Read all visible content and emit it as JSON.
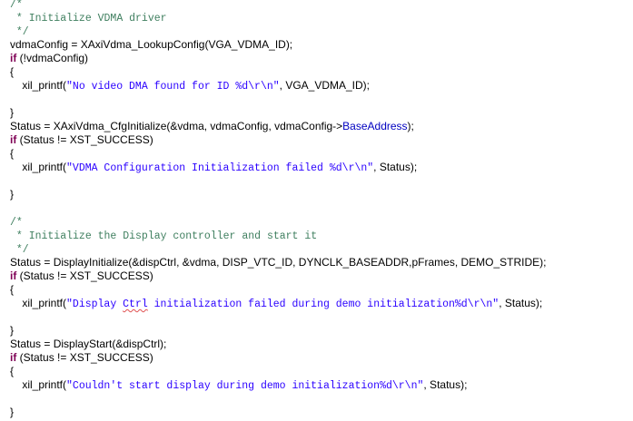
{
  "editor": {
    "lines": [
      {
        "tokens": [
          {
            "type": "comment",
            "text": "/*"
          }
        ]
      },
      {
        "tokens": [
          {
            "type": "comment",
            "text": " * Initialize VDMA driver"
          }
        ]
      },
      {
        "tokens": [
          {
            "type": "comment",
            "text": " */"
          }
        ]
      },
      {
        "tokens": [
          {
            "type": "plain",
            "text": "vdmaConfig = XAxiVdma_LookupConfig(VGA_VDMA_ID);"
          }
        ]
      },
      {
        "tokens": [
          {
            "type": "keyword",
            "text": "if"
          },
          {
            "type": "plain",
            "text": " (!vdmaConfig)"
          }
        ]
      },
      {
        "tokens": [
          {
            "type": "plain",
            "text": "{"
          }
        ]
      },
      {
        "tokens": [
          {
            "type": "plain",
            "text": "    xil_printf("
          },
          {
            "type": "string",
            "text": "\"No video DMA found for ID %d\\r\\n\""
          },
          {
            "type": "plain",
            "text": ", VGA_VDMA_ID);"
          }
        ]
      },
      {
        "tokens": []
      },
      {
        "tokens": [
          {
            "type": "plain",
            "text": "}"
          }
        ]
      },
      {
        "tokens": [
          {
            "type": "plain",
            "text": "Status = XAxiVdma_CfgInitialize(&vdma, vdmaConfig, vdmaConfig->"
          },
          {
            "type": "field",
            "text": "BaseAddress"
          },
          {
            "type": "plain",
            "text": ");"
          }
        ]
      },
      {
        "tokens": [
          {
            "type": "keyword",
            "text": "if"
          },
          {
            "type": "plain",
            "text": " (Status != XST_SUCCESS)"
          }
        ]
      },
      {
        "tokens": [
          {
            "type": "plain",
            "text": "{"
          }
        ]
      },
      {
        "tokens": [
          {
            "type": "plain",
            "text": "    xil_printf("
          },
          {
            "type": "string",
            "text": "\"VDMA Configuration Initialization failed %d\\r\\n\""
          },
          {
            "type": "plain",
            "text": ", Status);"
          }
        ]
      },
      {
        "tokens": []
      },
      {
        "tokens": [
          {
            "type": "plain",
            "text": "}"
          }
        ]
      },
      {
        "tokens": []
      },
      {
        "tokens": [
          {
            "type": "comment",
            "text": "/*"
          }
        ]
      },
      {
        "tokens": [
          {
            "type": "comment",
            "text": " * Initialize the Display controller and start it"
          }
        ]
      },
      {
        "tokens": [
          {
            "type": "comment",
            "text": " */"
          }
        ]
      },
      {
        "tokens": [
          {
            "type": "plain",
            "text": "Status = DisplayInitialize(&dispCtrl, &vdma, DISP_VTC_ID, DYNCLK_BASEADDR,pFrames, DEMO_STRIDE);"
          }
        ]
      },
      {
        "tokens": [
          {
            "type": "keyword",
            "text": "if"
          },
          {
            "type": "plain",
            "text": " (Status != XST_SUCCESS)"
          }
        ]
      },
      {
        "tokens": [
          {
            "type": "plain",
            "text": "{"
          }
        ]
      },
      {
        "tokens": [
          {
            "type": "plain",
            "text": "    xil_printf("
          },
          {
            "type": "string",
            "text": "\"Display "
          },
          {
            "type": "spell",
            "text": "Ctrl"
          },
          {
            "type": "string",
            "text": " initialization failed during demo initialization%d\\r\\n\""
          },
          {
            "type": "plain",
            "text": ", Status);"
          }
        ]
      },
      {
        "tokens": []
      },
      {
        "tokens": [
          {
            "type": "plain",
            "text": "}"
          }
        ]
      },
      {
        "tokens": [
          {
            "type": "plain",
            "text": "Status = DisplayStart(&dispCtrl);"
          }
        ]
      },
      {
        "tokens": [
          {
            "type": "keyword",
            "text": "if"
          },
          {
            "type": "plain",
            "text": " (Status != XST_SUCCESS)"
          }
        ]
      },
      {
        "tokens": [
          {
            "type": "plain",
            "text": "{"
          }
        ]
      },
      {
        "tokens": [
          {
            "type": "plain",
            "text": "    xil_printf("
          },
          {
            "type": "string",
            "text": "\"Couldn't start display during demo initialization%d\\r\\n\""
          },
          {
            "type": "plain",
            "text": ", Status);"
          }
        ]
      },
      {
        "tokens": []
      },
      {
        "tokens": [
          {
            "type": "plain",
            "text": "}"
          }
        ]
      }
    ]
  },
  "colors": {
    "background": "#ffffff",
    "plain": "#000000",
    "comment": "#3f7f5f",
    "string": "#2a00ff",
    "keyword": "#7f0055",
    "field": "#0000c0",
    "spellcheck_underline": "#e05050"
  }
}
